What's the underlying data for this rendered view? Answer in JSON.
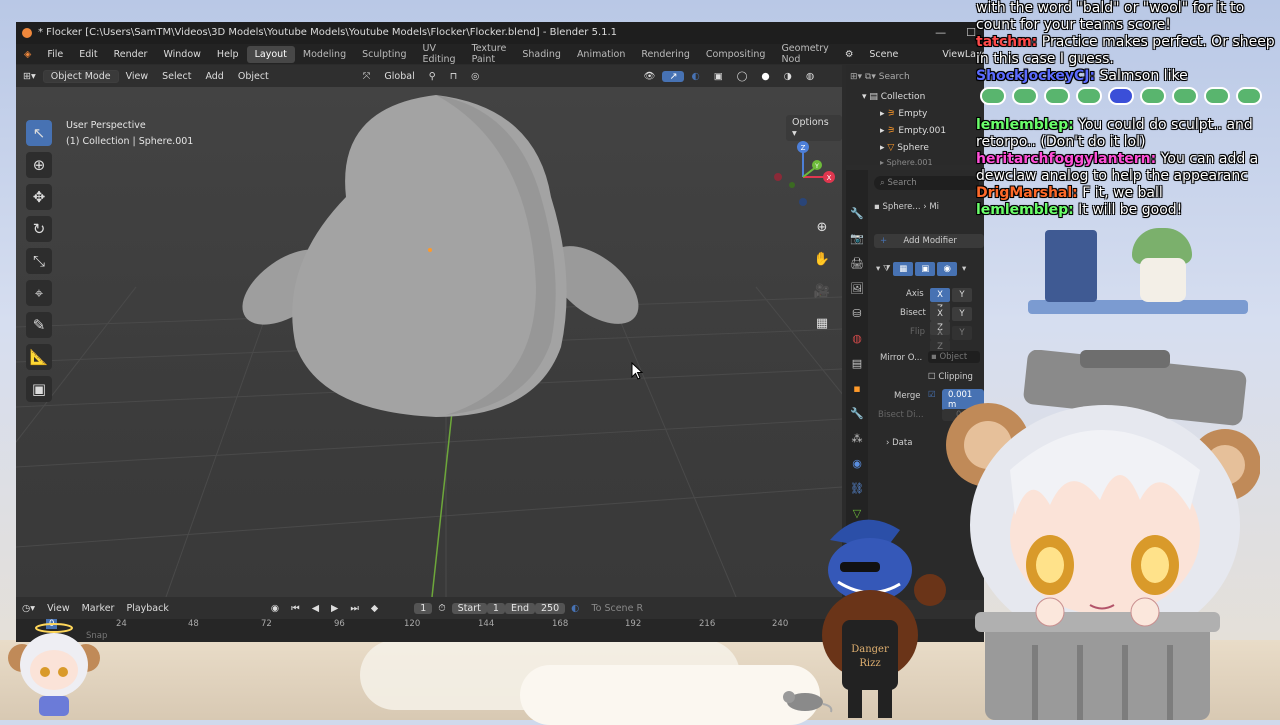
{
  "window": {
    "title": "* Flocker [C:\\Users\\SamTM\\Videos\\3D Models\\Youtube Models\\Youtube Models\\Flocker\\Flocker.blend] - Blender 5.1.1",
    "controls": [
      "—",
      "☐"
    ]
  },
  "menubar": {
    "menus": [
      "File",
      "Edit",
      "Render",
      "Window",
      "Help"
    ],
    "workspaces": [
      "Layout",
      "Modeling",
      "Sculpting",
      "UV Editing",
      "Texture Paint",
      "Shading",
      "Animation",
      "Rendering",
      "Compositing",
      "Geometry Nod"
    ],
    "active_workspace": "Layout",
    "scene": "Scene",
    "view_layer": "ViewLayer"
  },
  "viewport_header": {
    "mode": "Object Mode",
    "menus": [
      "View",
      "Select",
      "Add",
      "Object"
    ],
    "orientation": "Global",
    "options_label": "Options"
  },
  "viewport": {
    "perspective": "User Perspective",
    "collection_info": "(1) Collection | Sphere.001",
    "gizmo_labels": [
      "Z",
      "Y",
      "X"
    ],
    "accent_color": "#4772b3"
  },
  "outliner": {
    "search_placeholder": "Search",
    "items": [
      "Collection",
      "Empty",
      "Empty.001",
      "Sphere",
      "Sphere.001"
    ]
  },
  "properties": {
    "search_placeholder": "Search",
    "breadcrumb": [
      "Sphere...",
      "Mi"
    ],
    "add_modifier": "Add Modifier",
    "axis_label": "Axis",
    "bisect_label": "Bisect",
    "flip_label": "Flip",
    "axes": [
      "X",
      "Y",
      "Z"
    ],
    "mirror_object_label": "Mirror O...",
    "mirror_object_placeholder": "Object",
    "clipping_label": "Clipping",
    "merge_label": "Merge",
    "merge_value": "0.001 m",
    "bisect_distance_label": "Bisect Di...",
    "bisect_distance_value": "0.001",
    "data_label": "Data"
  },
  "timeline": {
    "menus": [
      "View",
      "Marker",
      "Playback"
    ],
    "current_frame": "1",
    "start_label": "Start",
    "start_value": "1",
    "end_label": "End",
    "end_value": "250",
    "scene_range": "To Scene R",
    "ruler": [
      "0",
      "24",
      "48",
      "72",
      "96",
      "120",
      "144",
      "168",
      "192",
      "216",
      "240"
    ],
    "snap_label": "Snap"
  },
  "chat": [
    {
      "user": "",
      "color": "#ffffff",
      "text": "with the word \"bald\" or \"wool\" for it to count for your teams score!"
    },
    {
      "user": "tatchm:",
      "color": "#ff4a4a",
      "text": "Practice makes perfect. Or sheep in this case I guess."
    },
    {
      "user": "ShockJockeyCJ:",
      "color": "#5b6bff",
      "text": "Salmson like"
    },
    {
      "user": "lemlemblep:",
      "color": "#6bff6b",
      "text": "You could do sculpt.. and retorpo.. (Don't do it lol)"
    },
    {
      "user": "heritarchfoggylantern:",
      "color": "#ff4fd8",
      "text": "You can add a dewclaw analog to help the appearanc"
    },
    {
      "user": "DrigMarshal:",
      "color": "#ff6a2a",
      "text": "F it, we ball"
    },
    {
      "user": "lemlemblep:",
      "color": "#6bff6b",
      "text": "It will be good!"
    }
  ],
  "mascot_shirt": [
    "Danger",
    "Rizz"
  ]
}
